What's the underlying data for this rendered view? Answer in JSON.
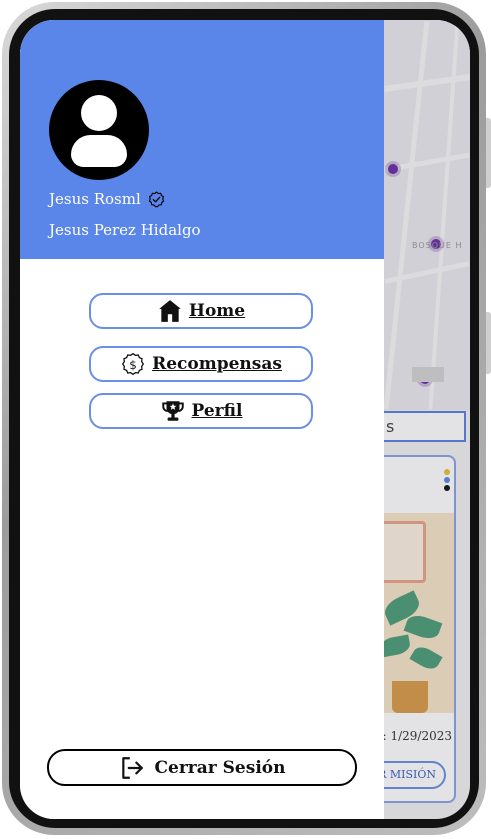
{
  "drawer": {
    "username": "Jesus Rosml",
    "full_name": "Jesus Perez Hidalgo",
    "nav": [
      {
        "label": "Home",
        "icon": "home-icon"
      },
      {
        "label": "Recompensas",
        "icon": "coin-icon"
      },
      {
        "label": "Perfil",
        "icon": "trophy-icon"
      }
    ],
    "logout_label": "Cerrar Sesión"
  },
  "background": {
    "map_street_label": "BOSQUE H",
    "search_text": "s",
    "card_date": ": 1/29/2023",
    "card_button": "R MISIÓN"
  },
  "colors": {
    "header": "#5a86ea",
    "nav_border": "#6b8ee8",
    "logout_border": "#000000"
  }
}
